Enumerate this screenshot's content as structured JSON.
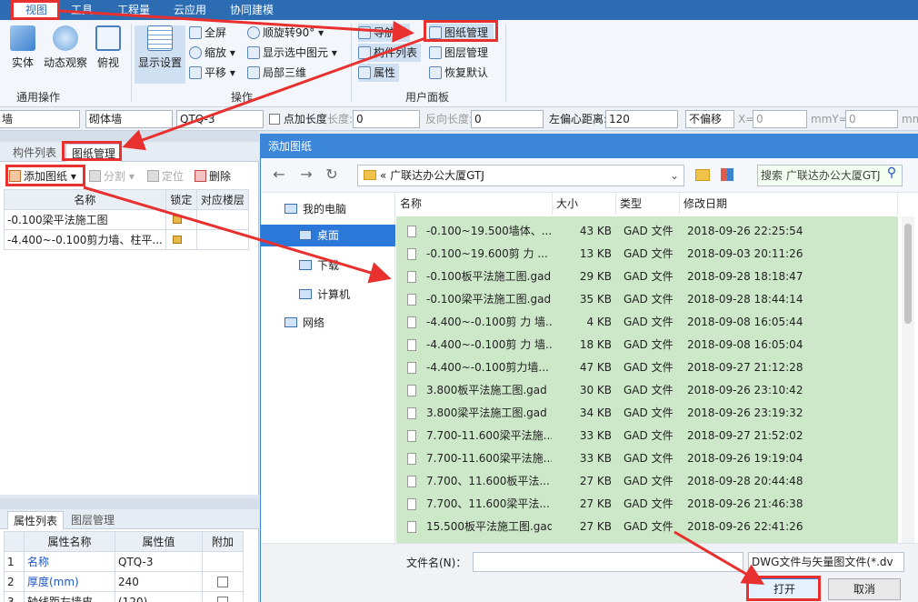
{
  "ribbon": {
    "tabs": [
      {
        "label": "视图"
      },
      {
        "label": "工具"
      },
      {
        "label": "工程量"
      },
      {
        "label": "云应用"
      },
      {
        "label": "协同建模"
      }
    ],
    "big_buttons": [
      {
        "label": "实体"
      },
      {
        "label": "动态观察"
      },
      {
        "label": "俯视"
      },
      {
        "label": "显示设置"
      }
    ],
    "small_buttons": [
      {
        "label": "全屏"
      },
      {
        "label": "缩放 ▾"
      },
      {
        "label": "平移 ▾"
      },
      {
        "label": "顺旋转90° ▾"
      },
      {
        "label": "显示选中图元 ▾"
      },
      {
        "label": "局部三维"
      }
    ],
    "panel_buttons": [
      {
        "label": "导航树"
      },
      {
        "label": "构件列表"
      },
      {
        "label": "属性"
      },
      {
        "label": "图纸管理"
      },
      {
        "label": "图层管理"
      },
      {
        "label": "恢复默认"
      }
    ],
    "groups": [
      {
        "label": "通用操作"
      },
      {
        "label": "操作"
      },
      {
        "label": "用户面板"
      }
    ]
  },
  "propbar": {
    "combo1": "墙",
    "combo2": "砌体墙",
    "combo3": "QTQ-3",
    "cb_label": "点加长度",
    "len_label": "长度:",
    "len_value": "0",
    "rev_label": "反向长度:",
    "rev_value": "0",
    "left_label": "左偏心距离:",
    "left_value": "120",
    "offset_value": "不偏移",
    "x_label": "X=",
    "x_value": "0",
    "y_label": "mmY=",
    "y_value": "0",
    "mm_label": "mm"
  },
  "drawing_panel": {
    "tabs": [
      {
        "label": "构件列表"
      },
      {
        "label": "图纸管理"
      }
    ],
    "tools": [
      {
        "label": "添加图纸 ▾"
      },
      {
        "label": "分割 ▾"
      },
      {
        "label": "定位"
      },
      {
        "label": "删除"
      }
    ],
    "columns": [
      "名称",
      "锁定",
      "对应楼层"
    ],
    "rows": [
      {
        "name": "-0.100梁平法施工图"
      },
      {
        "name": "-4.400~-0.100剪力墙、柱平..."
      }
    ]
  },
  "prop_panel": {
    "tabs": [
      {
        "label": "属性列表"
      },
      {
        "label": "图层管理"
      }
    ],
    "columns": [
      "属性名称",
      "属性值",
      "附加"
    ],
    "rows": [
      {
        "no": "1",
        "name": "名称",
        "value": "QTQ-3"
      },
      {
        "no": "2",
        "name": "厚度(mm)",
        "value": "240"
      },
      {
        "no": "3",
        "name": "轴线距左墙皮...",
        "value": "(120)"
      }
    ]
  },
  "dialog": {
    "title": "添加图纸",
    "address": "« 广联达办公大厦GTJ",
    "search_placeholder": "搜索 广联达办公大厦GTJ",
    "tree": [
      {
        "label": "我的电脑"
      },
      {
        "label": "桌面"
      },
      {
        "label": "下载"
      },
      {
        "label": "计算机"
      },
      {
        "label": "网络"
      }
    ],
    "columns": [
      "名称",
      "大小",
      "类型",
      "修改日期"
    ],
    "files": [
      {
        "name": "-0.100~19.500墙体、...",
        "size": "43 KB",
        "type": "GAD 文件",
        "date": "2018-09-26 22:25:54"
      },
      {
        "name": "-0.100~19.600剪 力 ...",
        "size": "13 KB",
        "type": "GAD 文件",
        "date": "2018-09-03 20:11:26"
      },
      {
        "name": "-0.100板平法施工图.gad",
        "size": "29 KB",
        "type": "GAD 文件",
        "date": "2018-09-28 18:18:47"
      },
      {
        "name": "-0.100梁平法施工图.gad",
        "size": "35 KB",
        "type": "GAD 文件",
        "date": "2018-09-28 18:44:14"
      },
      {
        "name": "-4.400~-0.100剪 力 墙...",
        "size": "4 KB",
        "type": "GAD 文件",
        "date": "2018-09-08 16:05:44"
      },
      {
        "name": "-4.400~-0.100剪 力 墙...",
        "size": "18 KB",
        "type": "GAD 文件",
        "date": "2018-09-08 16:05:04"
      },
      {
        "name": "-4.400~-0.100剪力墙...",
        "size": "47 KB",
        "type": "GAD 文件",
        "date": "2018-09-27 21:12:28"
      },
      {
        "name": "3.800板平法施工图.gad",
        "size": "30 KB",
        "type": "GAD 文件",
        "date": "2018-09-26 23:10:42"
      },
      {
        "name": "3.800梁平法施工图.gad",
        "size": "34 KB",
        "type": "GAD 文件",
        "date": "2018-09-26 23:19:32"
      },
      {
        "name": "7.700-11.600梁平法施...",
        "size": "33 KB",
        "type": "GAD 文件",
        "date": "2018-09-27 21:52:02"
      },
      {
        "name": "7.700-11.600梁平法施...",
        "size": "33 KB",
        "type": "GAD 文件",
        "date": "2018-09-26 19:19:04"
      },
      {
        "name": "7.700、11.600板平法...",
        "size": "27 KB",
        "type": "GAD 文件",
        "date": "2018-09-28 20:44:48"
      },
      {
        "name": "7.700、11.600梁平法...",
        "size": "27 KB",
        "type": "GAD 文件",
        "date": "2018-09-26 21:46:38"
      },
      {
        "name": "15.500板平法施工图.gad",
        "size": "27 KB",
        "type": "GAD 文件",
        "date": "2018-09-26 22:41:26"
      }
    ],
    "filename_label": "文件名(N)：",
    "filetype": "DWG文件与矢量图文件(*.dv",
    "open_label": "打开",
    "cancel_label": "取消"
  },
  "colors": {
    "accent": "#2b6cb3",
    "highlight": "#e8312f",
    "selection_green": "#cde8c9"
  }
}
